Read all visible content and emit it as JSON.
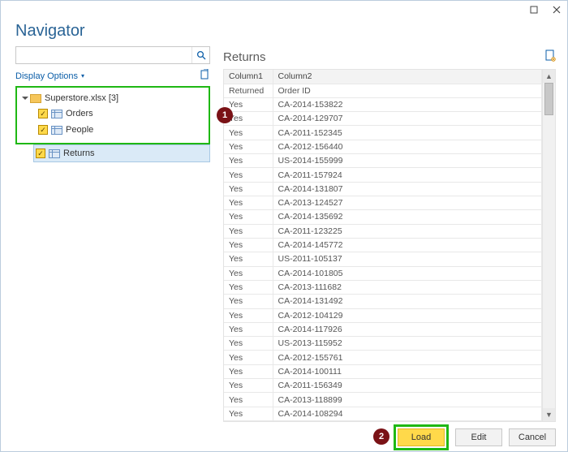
{
  "title": "Navigator",
  "search": {
    "placeholder": ""
  },
  "display_options_label": "Display Options",
  "tree": {
    "file": {
      "name": "Superstore.xlsx [3]"
    },
    "sheets": [
      {
        "label": "Orders"
      },
      {
        "label": "People"
      },
      {
        "label": "Returns"
      }
    ]
  },
  "annotations": {
    "b1": "1",
    "b2": "2"
  },
  "preview": {
    "title": "Returns",
    "columns": [
      "Column1",
      "Column2"
    ],
    "header_row": [
      "Returned",
      "Order ID"
    ],
    "rows": [
      [
        "Yes",
        "CA-2014-153822"
      ],
      [
        "Yes",
        "CA-2014-129707"
      ],
      [
        "Yes",
        "CA-2011-152345"
      ],
      [
        "Yes",
        "CA-2012-156440"
      ],
      [
        "Yes",
        "US-2014-155999"
      ],
      [
        "Yes",
        "CA-2011-157924"
      ],
      [
        "Yes",
        "CA-2014-131807"
      ],
      [
        "Yes",
        "CA-2013-124527"
      ],
      [
        "Yes",
        "CA-2014-135692"
      ],
      [
        "Yes",
        "CA-2011-123225"
      ],
      [
        "Yes",
        "CA-2014-145772"
      ],
      [
        "Yes",
        "US-2011-105137"
      ],
      [
        "Yes",
        "CA-2014-101805"
      ],
      [
        "Yes",
        "CA-2013-111682"
      ],
      [
        "Yes",
        "CA-2014-131492"
      ],
      [
        "Yes",
        "CA-2012-104129"
      ],
      [
        "Yes",
        "CA-2014-117926"
      ],
      [
        "Yes",
        "US-2013-115952"
      ],
      [
        "Yes",
        "CA-2012-155761"
      ],
      [
        "Yes",
        "CA-2014-100111"
      ],
      [
        "Yes",
        "CA-2011-156349"
      ],
      [
        "Yes",
        "CA-2013-118899"
      ],
      [
        "Yes",
        "CA-2014-108294"
      ]
    ]
  },
  "buttons": {
    "load": "Load",
    "edit": "Edit",
    "cancel": "Cancel"
  }
}
